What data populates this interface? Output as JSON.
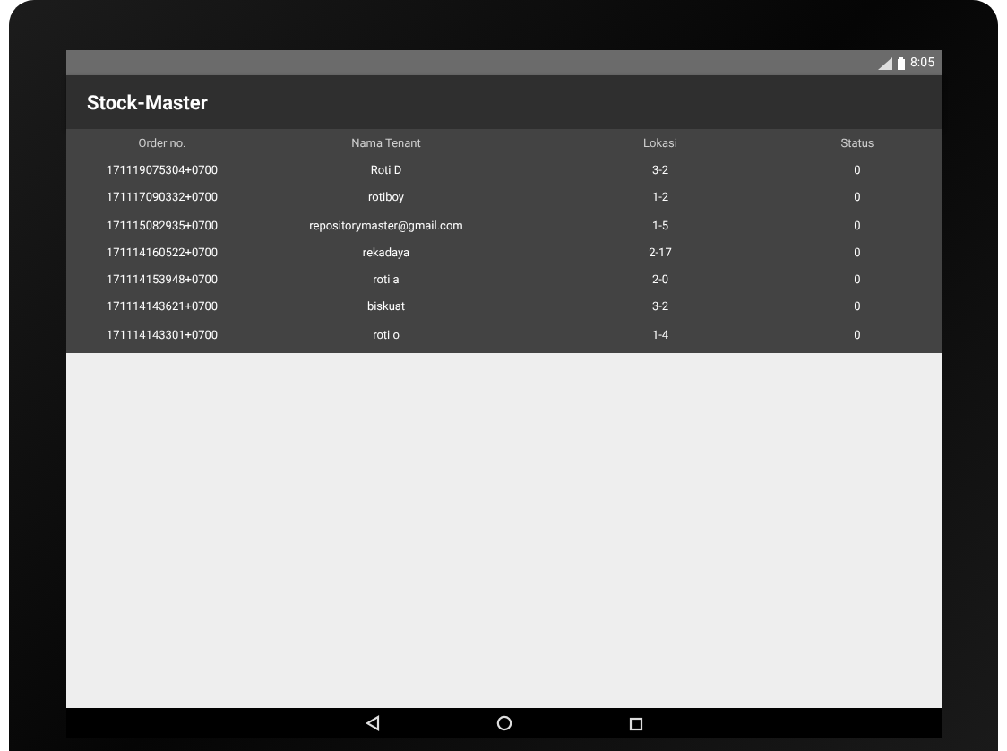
{
  "status_bar": {
    "time": "8:05"
  },
  "app_bar": {
    "title": "Stock-Master"
  },
  "table": {
    "columns": [
      "Order no.",
      "Nama Tenant",
      "Lokasi",
      "Status"
    ],
    "rows": [
      [
        "171119075304+0700",
        "Roti D",
        "3-2",
        "0"
      ],
      [
        "171117090332+0700",
        "rotiboy",
        "1-2",
        "0"
      ],
      [
        "171115082935+0700",
        "repositorymaster@gmail.com",
        "1-5",
        "0"
      ],
      [
        "171114160522+0700",
        "rekadaya",
        "2-17",
        "0"
      ],
      [
        "171114153948+0700",
        "roti a",
        "2-0",
        "0"
      ],
      [
        "171114143621+0700",
        "biskuat",
        "3-2",
        "0"
      ],
      [
        "171114143301+0700",
        "roti o",
        "1-4",
        "0"
      ]
    ]
  }
}
